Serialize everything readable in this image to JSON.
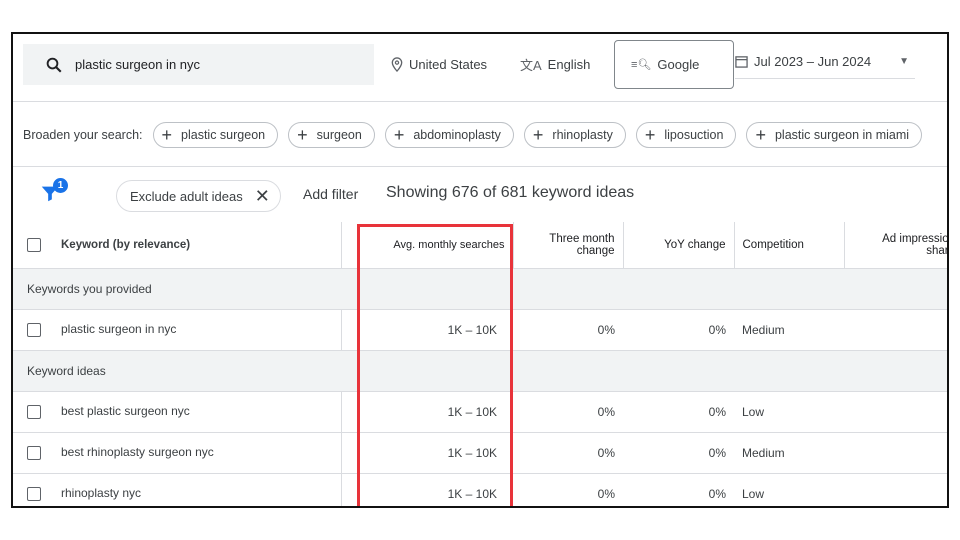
{
  "search": {
    "query": "plastic surgeon in nyc",
    "location": "United States",
    "language": "English",
    "network": "Google",
    "date_range": "Jul 2023 – Jun 2024"
  },
  "broaden": {
    "label": "Broaden your search:",
    "chips": [
      "plastic surgeon",
      "surgeon",
      "abdominoplasty",
      "rhinoplasty",
      "liposuction",
      "plastic surgeon in miami"
    ]
  },
  "filters": {
    "badge_count": "1",
    "chip": "Exclude adult ideas",
    "add_filter": "Add filter",
    "showing": "Showing 676 of 681 keyword ideas"
  },
  "table": {
    "headers": [
      "Keyword (by relevance)",
      "Avg. monthly searches",
      "Three month change",
      "YoY change",
      "Competition",
      "Ad impression share"
    ],
    "groups": [
      {
        "label": "Keywords you provided",
        "rows": [
          {
            "keyword": "plastic surgeon in nyc",
            "avg": "1K – 10K",
            "three": "0%",
            "yoy": "0%",
            "comp": "Medium",
            "share": "–"
          }
        ]
      },
      {
        "label": "Keyword ideas",
        "rows": [
          {
            "keyword": "best plastic surgeon nyc",
            "avg": "1K – 10K",
            "three": "0%",
            "yoy": "0%",
            "comp": "Low",
            "share": "–"
          },
          {
            "keyword": "best rhinoplasty surgeon nyc",
            "avg": "1K – 10K",
            "three": "0%",
            "yoy": "0%",
            "comp": "Medium",
            "share": "–"
          },
          {
            "keyword": "rhinoplasty nyc",
            "avg": "1K – 10K",
            "three": "0%",
            "yoy": "0%",
            "comp": "Low",
            "share": "–"
          }
        ]
      }
    ]
  },
  "colors": {
    "highlight": "#e8333a",
    "accent": "#1a73e8"
  }
}
